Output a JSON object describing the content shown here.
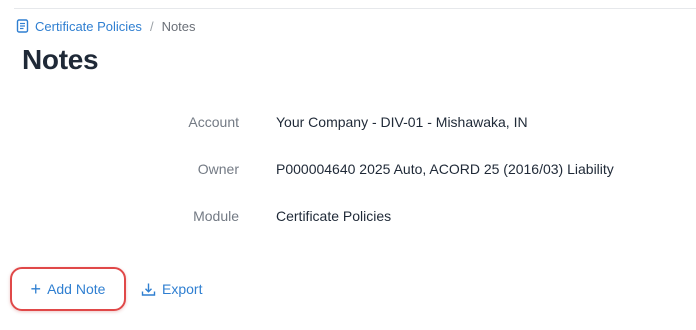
{
  "breadcrumb": {
    "parent_label": "Certificate Policies",
    "separator": "/",
    "current_label": "Notes"
  },
  "page": {
    "title": "Notes"
  },
  "details": [
    {
      "label": "Account",
      "value": "Your Company - DIV-01 - Mishawaka, IN"
    },
    {
      "label": "Owner",
      "value": "P000004640 2025 Auto, ACORD 25 (2016/03) Liability"
    },
    {
      "label": "Module",
      "value": "Certificate Policies"
    }
  ],
  "actions": {
    "add_note_label": "Add Note",
    "add_note_icon": "plus-icon",
    "export_label": "Export",
    "export_icon": "download-icon"
  },
  "colors": {
    "link": "#2f7fd1",
    "highlight": "#e04848",
    "title": "#1f2937",
    "muted": "#737a84"
  }
}
